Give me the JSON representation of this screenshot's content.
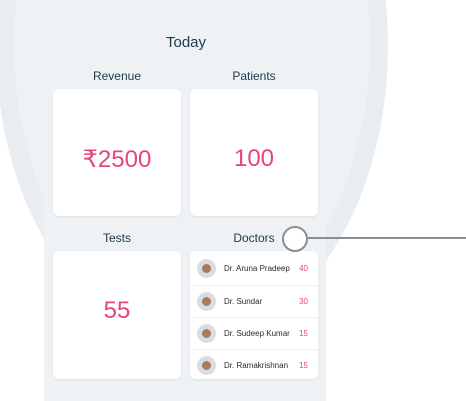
{
  "title": "Today",
  "metrics": {
    "revenue": {
      "label": "Revenue",
      "value": "₹2500"
    },
    "patients": {
      "label": "Patients",
      "value": "100"
    },
    "tests": {
      "label": "Tests",
      "value": "55"
    }
  },
  "doctors": {
    "label": "Doctors",
    "items": [
      {
        "name": "Dr. Aruna Pradeep",
        "count": "40"
      },
      {
        "name": "Dr. Sundar",
        "count": "30"
      },
      {
        "name": "Dr. Sudeep Kumar",
        "count": "15"
      },
      {
        "name": "Dr. Ramakrishnan",
        "count": "15"
      }
    ]
  },
  "colors": {
    "accent": "#e6457a",
    "text": "#1d3948",
    "background": "#eef2f5"
  }
}
